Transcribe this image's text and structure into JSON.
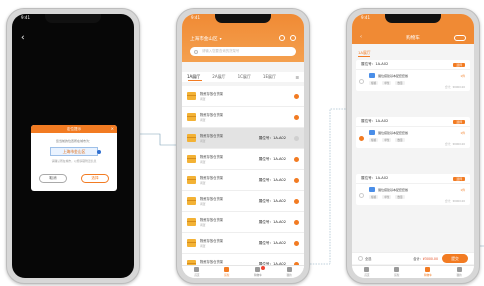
{
  "phone1": {
    "time": "9:41",
    "dialog": {
      "title": "定位提示",
      "desc": "您当前的位置所在城市为：",
      "city": "上海市金山区",
      "note": "请确认所在城市，以便获取附近信息",
      "cancel_label": "取消",
      "confirm_label": "选择"
    }
  },
  "phone2": {
    "time": "9:41",
    "city": "上海市金山区",
    "search_placeholder": "请输入您要查询的货架号",
    "tabs": [
      "1A展厅",
      "2A展厅",
      "1C展厅",
      "1E展厅",
      "2F"
    ],
    "rows": [
      {
        "name": "物资存放仓货架",
        "sub": "闲置",
        "code": "",
        "selected": false
      },
      {
        "name": "物资存放仓货架",
        "sub": "闲置",
        "code": "",
        "selected": false
      },
      {
        "name": "物资存放仓货架",
        "sub": "闲置",
        "code": "",
        "selected": false
      },
      {
        "name": "物资存放仓货架",
        "sub": "闲置",
        "code": "",
        "selected": false
      },
      {
        "name": "物资存放仓货架",
        "sub": "闲置",
        "code": "",
        "selected": false
      },
      {
        "name": "物资存放仓货架",
        "sub": "闲置",
        "code": "",
        "selected": false
      },
      {
        "name": "物资存放仓货架",
        "sub": "闲置",
        "code": "",
        "selected": false
      },
      {
        "name": "物资存放仓货架",
        "sub": "闲置",
        "code": "",
        "selected": false
      },
      {
        "name": "物资存放仓货架",
        "sub": "闲置",
        "code": "",
        "selected": false
      }
    ],
    "row_codes": [
      "展位号：1A-A02",
      "展位号：1A-A02",
      "展位号：1A-A02",
      "展位号：1A-A02",
      "展位号：1A-A02",
      "展位号：1A-A02",
      "展位号：1A-A02",
      "展位号：1A-A02",
      "展位号：1A-A02"
    ],
    "tabbar": [
      "首页",
      "货架",
      "购物车",
      "我的"
    ]
  },
  "phone3": {
    "time": "9:41",
    "title": "购物车",
    "hall": "1A展厅",
    "cards": [
      {
        "booth": "展位号：1A-A02",
        "tag": "选择",
        "items": [
          {
            "name": "展位搭建基本配套套餐",
            "qty": "1件",
            "meta": [
              "规格",
              "单位",
              "数量"
            ],
            "foot": "合计：¥0000.00"
          }
        ]
      },
      {
        "booth": "展位号：1A-A02",
        "tag": "选择",
        "items": [
          {
            "name": "展位搭建基本配套套餐",
            "qty": "1件",
            "meta": [
              "规格",
              "单位",
              "数量"
            ],
            "foot": "合计：¥0000.00"
          }
        ]
      },
      {
        "booth": "展位号：1A-A02",
        "tag": "选择",
        "items": [
          {
            "name": "展位搭建基本配套套餐",
            "qty": "1件",
            "meta": [
              "规格",
              "单位",
              "数量"
            ],
            "foot": "合计：¥0000.00"
          }
        ]
      }
    ],
    "select_all": "全选",
    "total_label": "合计：",
    "total_value": "¥3000.00",
    "pay_label": "提交",
    "tabbar": [
      "首页",
      "货架",
      "购物车",
      "我的"
    ]
  },
  "colors": {
    "accent": "#f27b22",
    "screen_dark": "#070707"
  }
}
